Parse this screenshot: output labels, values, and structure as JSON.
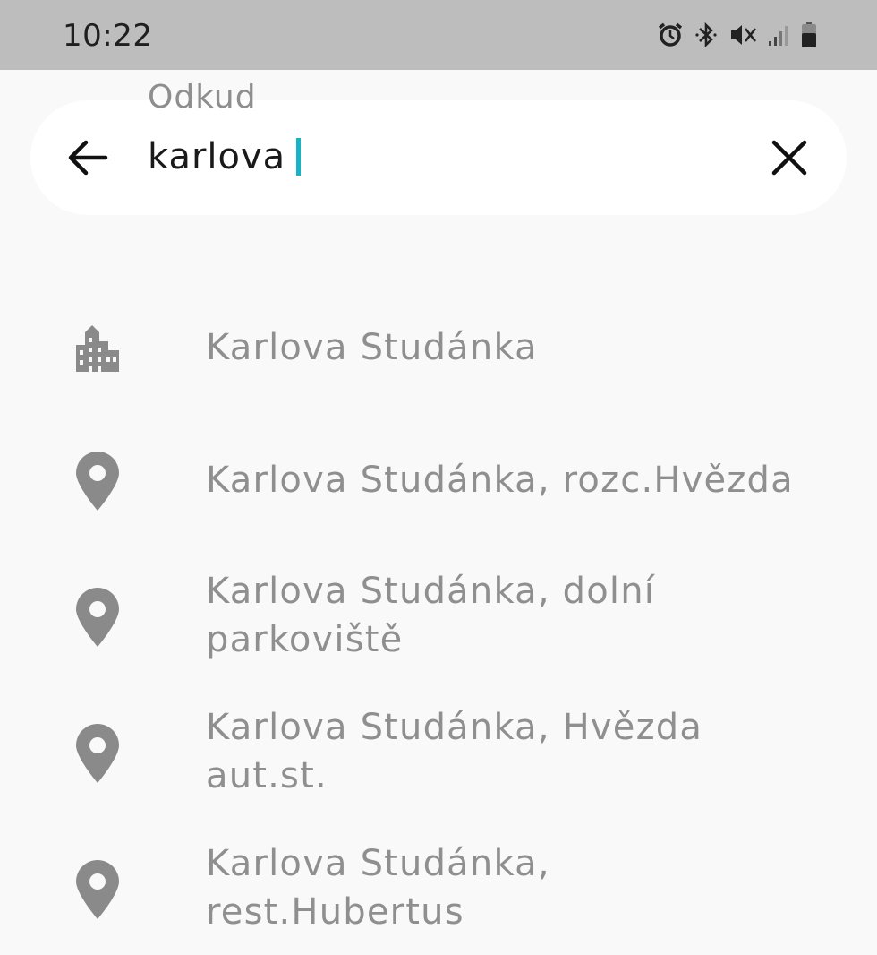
{
  "status_bar": {
    "time": "10:22",
    "icons": [
      "alarm-icon",
      "bluetooth-icon",
      "vibrate-mute-icon",
      "signal-icon",
      "battery-icon"
    ]
  },
  "search": {
    "field_label": "Odkud",
    "value": "karlova",
    "back_icon": "arrow-left-icon",
    "clear_icon": "close-icon",
    "caret_color": "#18b4c6"
  },
  "results": [
    {
      "icon": "city-icon",
      "label": "Karlova Studánka"
    },
    {
      "icon": "location-pin-icon",
      "label": "Karlova Studánka, rozc.Hvězda"
    },
    {
      "icon": "location-pin-icon",
      "label": "Karlova Studánka, dolní parkoviště"
    },
    {
      "icon": "location-pin-icon",
      "label": "Karlova Studánka, Hvězda aut.st."
    },
    {
      "icon": "location-pin-icon",
      "label": "Karlova Studánka, rest.Hubertus"
    }
  ],
  "colors": {
    "status_bar": "#bdbdbd",
    "background": "#f9f9f9",
    "result_text": "#8f8f8f",
    "icon_gray": "#8a8a8a"
  }
}
